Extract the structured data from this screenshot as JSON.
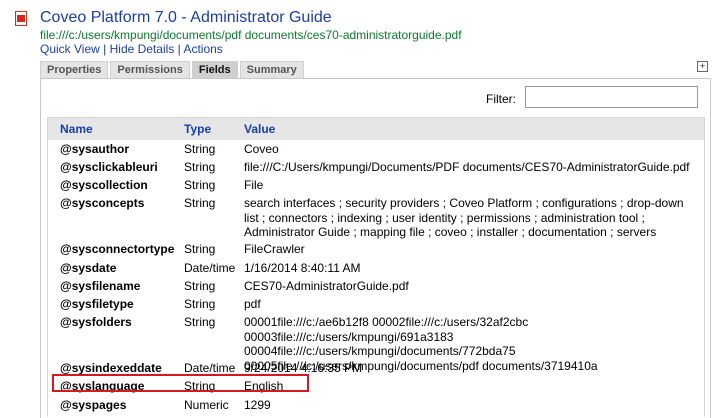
{
  "doc": {
    "title": "Coveo Platform 7.0 - Administrator Guide",
    "uri": "file:///c:/users/kmpungi/documents/pdf documents/ces70-administratorguide.pdf",
    "links": [
      "Quick View",
      "Hide Details",
      "Actions"
    ],
    "separator": " | "
  },
  "tabs": [
    {
      "label": "Properties",
      "active": false
    },
    {
      "label": "Permissions",
      "active": false
    },
    {
      "label": "Fields",
      "active": true
    },
    {
      "label": "Summary",
      "active": false
    }
  ],
  "expand_symbol": "+",
  "filter": {
    "label": "Filter:",
    "value": ""
  },
  "table": {
    "columns": [
      "Name",
      "Type",
      "Value"
    ],
    "rows": [
      {
        "name": "@sysauthor",
        "type": "String",
        "value": "Coveo"
      },
      {
        "name": "@sysclickableuri",
        "type": "String",
        "value": "file:///C:/Users/kmpungi/Documents/PDF documents/CES70-AdministratorGuide.pdf"
      },
      {
        "name": "@syscollection",
        "type": "String",
        "value": "File"
      },
      {
        "name": "@sysconcepts",
        "type": "String",
        "value": "search interfaces ; security providers ; Coveo Platform ; configurations ; drop-down list ; connectors ; indexing ; user identity ; permissions ; administration tool ; Administrator Guide ; mapping file ; coveo ; installer ; documentation ; servers"
      },
      {
        "name": "@sysconnectortype",
        "type": "String",
        "value": "FileCrawler"
      },
      {
        "name": "@sysdate",
        "type": "Date/time",
        "value": "1/16/2014 8:40:11 AM"
      },
      {
        "name": "@sysfilename",
        "type": "String",
        "value": "CES70-AdministratorGuide.pdf"
      },
      {
        "name": "@sysfiletype",
        "type": "String",
        "value": "pdf"
      },
      {
        "name": "@sysfolders",
        "type": "String",
        "value": "00001file:///c:/ae6b12f8 00002file:///c:/users/32af2cbc 00003file:///c:/users/kmpungi/691a3183 00004file:///c:/users/kmpungi/documents/772bda75 00005file:///c:/users/kmpungi/documents/pdf documents/3719410a"
      },
      {
        "name": "@sysindexeddate",
        "type": "Date/time",
        "value": "9/24/2014 4:16:35 PM"
      },
      {
        "name": "@syslanguage",
        "type": "String",
        "value": "English"
      },
      {
        "name": "@syspages",
        "type": "Numeric",
        "value": "1299"
      }
    ]
  },
  "colors": {
    "link": "#1a3ea6",
    "uri": "#0a7a2c",
    "highlight": "#d7181f"
  }
}
